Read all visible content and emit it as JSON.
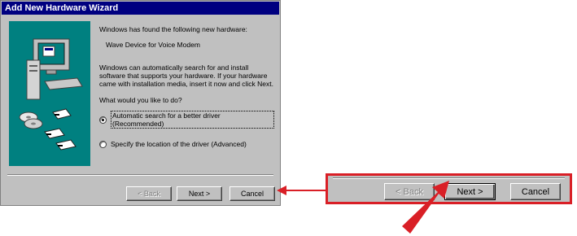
{
  "window": {
    "title": "Add New Hardware Wizard",
    "found_text": "Windows has found the following new hardware:",
    "device_name": "Wave Device for Voice Modem",
    "description": "Windows can automatically search for and install software that supports your hardware. If your hardware came with installation media, insert it now and click Next.",
    "question": "What would you like to do?",
    "options": [
      {
        "label": "Automatic search for a better driver (Recommended)",
        "selected": true
      },
      {
        "label": "Specify the location of the driver (Advanced)",
        "selected": false
      }
    ],
    "buttons": {
      "back": "< Back",
      "next": "Next >",
      "cancel": "Cancel"
    }
  },
  "zoom": {
    "buttons": {
      "back": "< Back",
      "next": "Next >",
      "cancel": "Cancel"
    }
  },
  "colors": {
    "highlight": "#d91f26",
    "title_bar": "#000080",
    "art_bg": "#008080"
  }
}
